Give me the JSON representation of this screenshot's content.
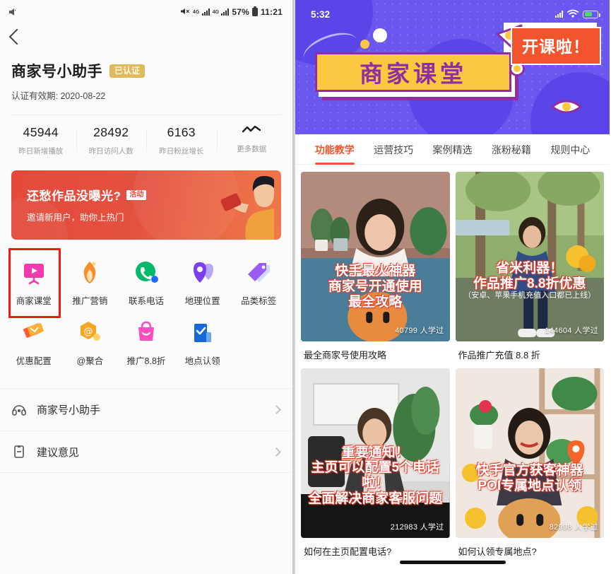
{
  "left_phone": {
    "status_bar": {
      "network": "4G",
      "battery": "57%",
      "time": "11:21",
      "mute_icon": "mute-icon"
    },
    "back_icon": "back-chevron-icon",
    "title": "商家号小助手",
    "verified_badge": "已认证",
    "subtitle": "认证有效期: 2020-08-22",
    "stats": [
      {
        "value": "45944",
        "label": "昨日新增播放"
      },
      {
        "value": "28492",
        "label": "昨日访问人数"
      },
      {
        "value": "6163",
        "label": "昨日粉丝增长"
      },
      {
        "value": "〜",
        "label": "更多数据"
      }
    ],
    "banner": {
      "title": "还愁作品没曝光?",
      "tag": "活动",
      "subtitle": "邀请新用户，助你上热门"
    },
    "grid": [
      {
        "label": "商家课堂",
        "icon": "classroom-icon",
        "selected": true
      },
      {
        "label": "推广营销",
        "icon": "flame-icon",
        "selected": false
      },
      {
        "label": "联系电话",
        "icon": "phone-icon",
        "selected": false
      },
      {
        "label": "地理位置",
        "icon": "location-pin-icon",
        "selected": false
      },
      {
        "label": "品类标签",
        "icon": "tag-icon",
        "selected": false
      },
      {
        "label": "优惠配置",
        "icon": "coupon-icon",
        "selected": false
      },
      {
        "label": "@聚合",
        "icon": "at-badge-icon",
        "selected": false
      },
      {
        "label": "推广8.8折",
        "icon": "shopping-bag-icon",
        "selected": false
      },
      {
        "label": "地点认领",
        "icon": "claim-check-icon",
        "selected": false
      }
    ],
    "list": [
      {
        "label": "商家号小助手",
        "icon": "headset-icon",
        "chevron": "chevron-right-icon"
      },
      {
        "label": "建议意见",
        "icon": "feedback-icon",
        "chevron": "chevron-right-icon"
      }
    ]
  },
  "right_phone": {
    "status_bar": {
      "time": "5:32",
      "signal_icon": "cellular-signal-icon",
      "wifi_icon": "wifi-icon",
      "battery_icon": "battery-icon"
    },
    "hero": {
      "plate_text": "商家课堂",
      "tag_text": "开课啦！",
      "plate_bg": "#fbc83f",
      "plate_text_color": "#8e2ea0",
      "tag_bg": "#f2542d",
      "background": "#6a57f0"
    },
    "tabs": [
      {
        "label": "功能教学",
        "active": true
      },
      {
        "label": "运营技巧",
        "active": false
      },
      {
        "label": "案例精选",
        "active": false
      },
      {
        "label": "涨粉秘籍",
        "active": false
      },
      {
        "label": "规则中心",
        "active": false
      }
    ],
    "accent_color": "#f2542d",
    "cards": [
      {
        "caption": "最全商家号使用攻略",
        "overlay_lines": [
          "快手最火神器",
          "商家号开通使用",
          "最全攻略"
        ],
        "overlay_note": "",
        "views": "40799 人学过"
      },
      {
        "caption": "作品推广充值 8.8 折",
        "overlay_lines": [
          "省米利器！",
          "作品推广8.8折优惠"
        ],
        "overlay_note": "（安卓、苹果手机充值入口都已上线）",
        "views": "144604 人学过"
      },
      {
        "caption": "如何在主页配置电话?",
        "overlay_lines": [
          "重要通知！",
          "主页可以配置5个电话啦！",
          "全面解决商家客服问题"
        ],
        "overlay_note": "",
        "views": "212983 人学过"
      },
      {
        "caption": "如何认领专属地点?",
        "overlay_lines": [
          "快手官方获客神器",
          "POI专属地点认领"
        ],
        "overlay_note": "",
        "views": "82998 人学过"
      }
    ]
  }
}
